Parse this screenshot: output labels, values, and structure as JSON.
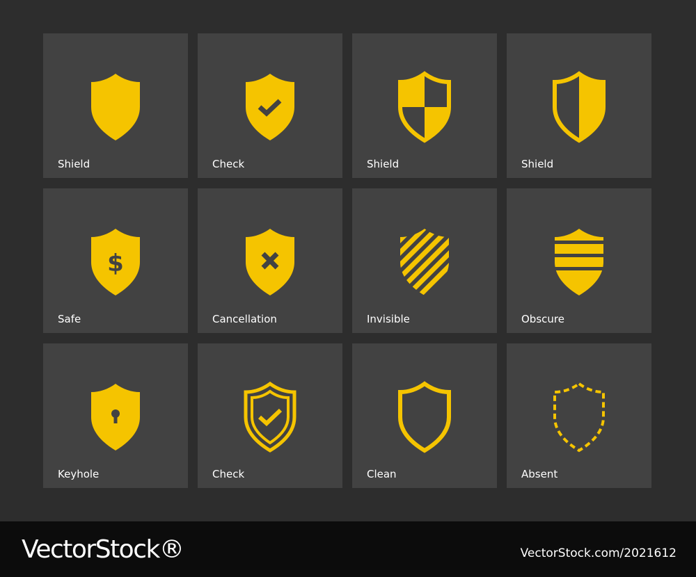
{
  "colors": {
    "background": "#2d2d2d",
    "tile": "#424242",
    "icon": "#f5c400",
    "footer": "#0c0c0c",
    "text": "#ffffff"
  },
  "icons": [
    {
      "label": "Shield",
      "icon": "shield-solid-icon"
    },
    {
      "label": "Check",
      "icon": "shield-check-solid-icon"
    },
    {
      "label": "Shield",
      "icon": "shield-quarters-icon"
    },
    {
      "label": "Shield",
      "icon": "shield-half-icon"
    },
    {
      "label": "Safe",
      "icon": "shield-dollar-icon"
    },
    {
      "label": "Cancellation",
      "icon": "shield-cross-icon"
    },
    {
      "label": "Invisible",
      "icon": "shield-diagonal-stripes-icon"
    },
    {
      "label": "Obscure",
      "icon": "shield-horizontal-stripes-icon"
    },
    {
      "label": "Keyhole",
      "icon": "shield-keyhole-icon"
    },
    {
      "label": "Check",
      "icon": "shield-check-outline-icon"
    },
    {
      "label": "Clean",
      "icon": "shield-outline-icon"
    },
    {
      "label": "Absent",
      "icon": "shield-dashed-icon"
    }
  ],
  "footer": {
    "brand": "VectorStock®",
    "image_id": "VectorStock.com/2021612"
  }
}
